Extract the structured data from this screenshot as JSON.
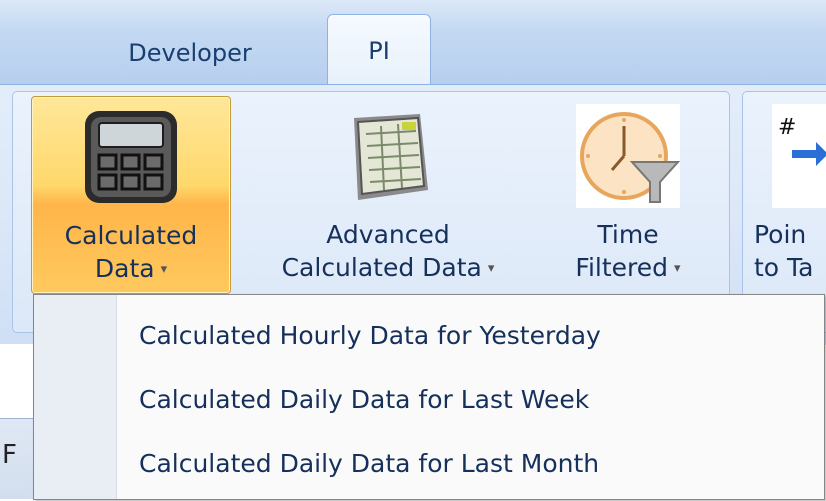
{
  "tabs": [
    {
      "label": "Developer",
      "active": false
    },
    {
      "label": "PI",
      "active": true
    }
  ],
  "ribbon": {
    "buttons": [
      {
        "line1": "Calculated",
        "line2": "Data",
        "icon": "calculator-icon",
        "has_dropdown": true,
        "state": "pressed"
      },
      {
        "line1": "Advanced",
        "line2": "Calculated Data",
        "icon": "spreadsheet-icon",
        "has_dropdown": true
      },
      {
        "line1": "Time",
        "line2": "Filtered",
        "icon": "clock-filter-icon",
        "has_dropdown": true
      },
      {
        "line1": "Poin",
        "line2": "to Ta",
        "icon": "point-to-tag-icon",
        "has_dropdown": false
      }
    ],
    "dropdown_arrow": "▾"
  },
  "menu": {
    "items": [
      {
        "label": "Calculated Hourly Data for Yesterday"
      },
      {
        "label": "Calculated Daily Data for Last Week"
      },
      {
        "label": "Calculated Daily Data for Last Month"
      }
    ]
  },
  "background": {
    "letter": "F"
  },
  "colors": {
    "accent_orange": "#ffb54a",
    "text_blue": "#15305a",
    "ribbon_blue": "#dbe7f8"
  }
}
